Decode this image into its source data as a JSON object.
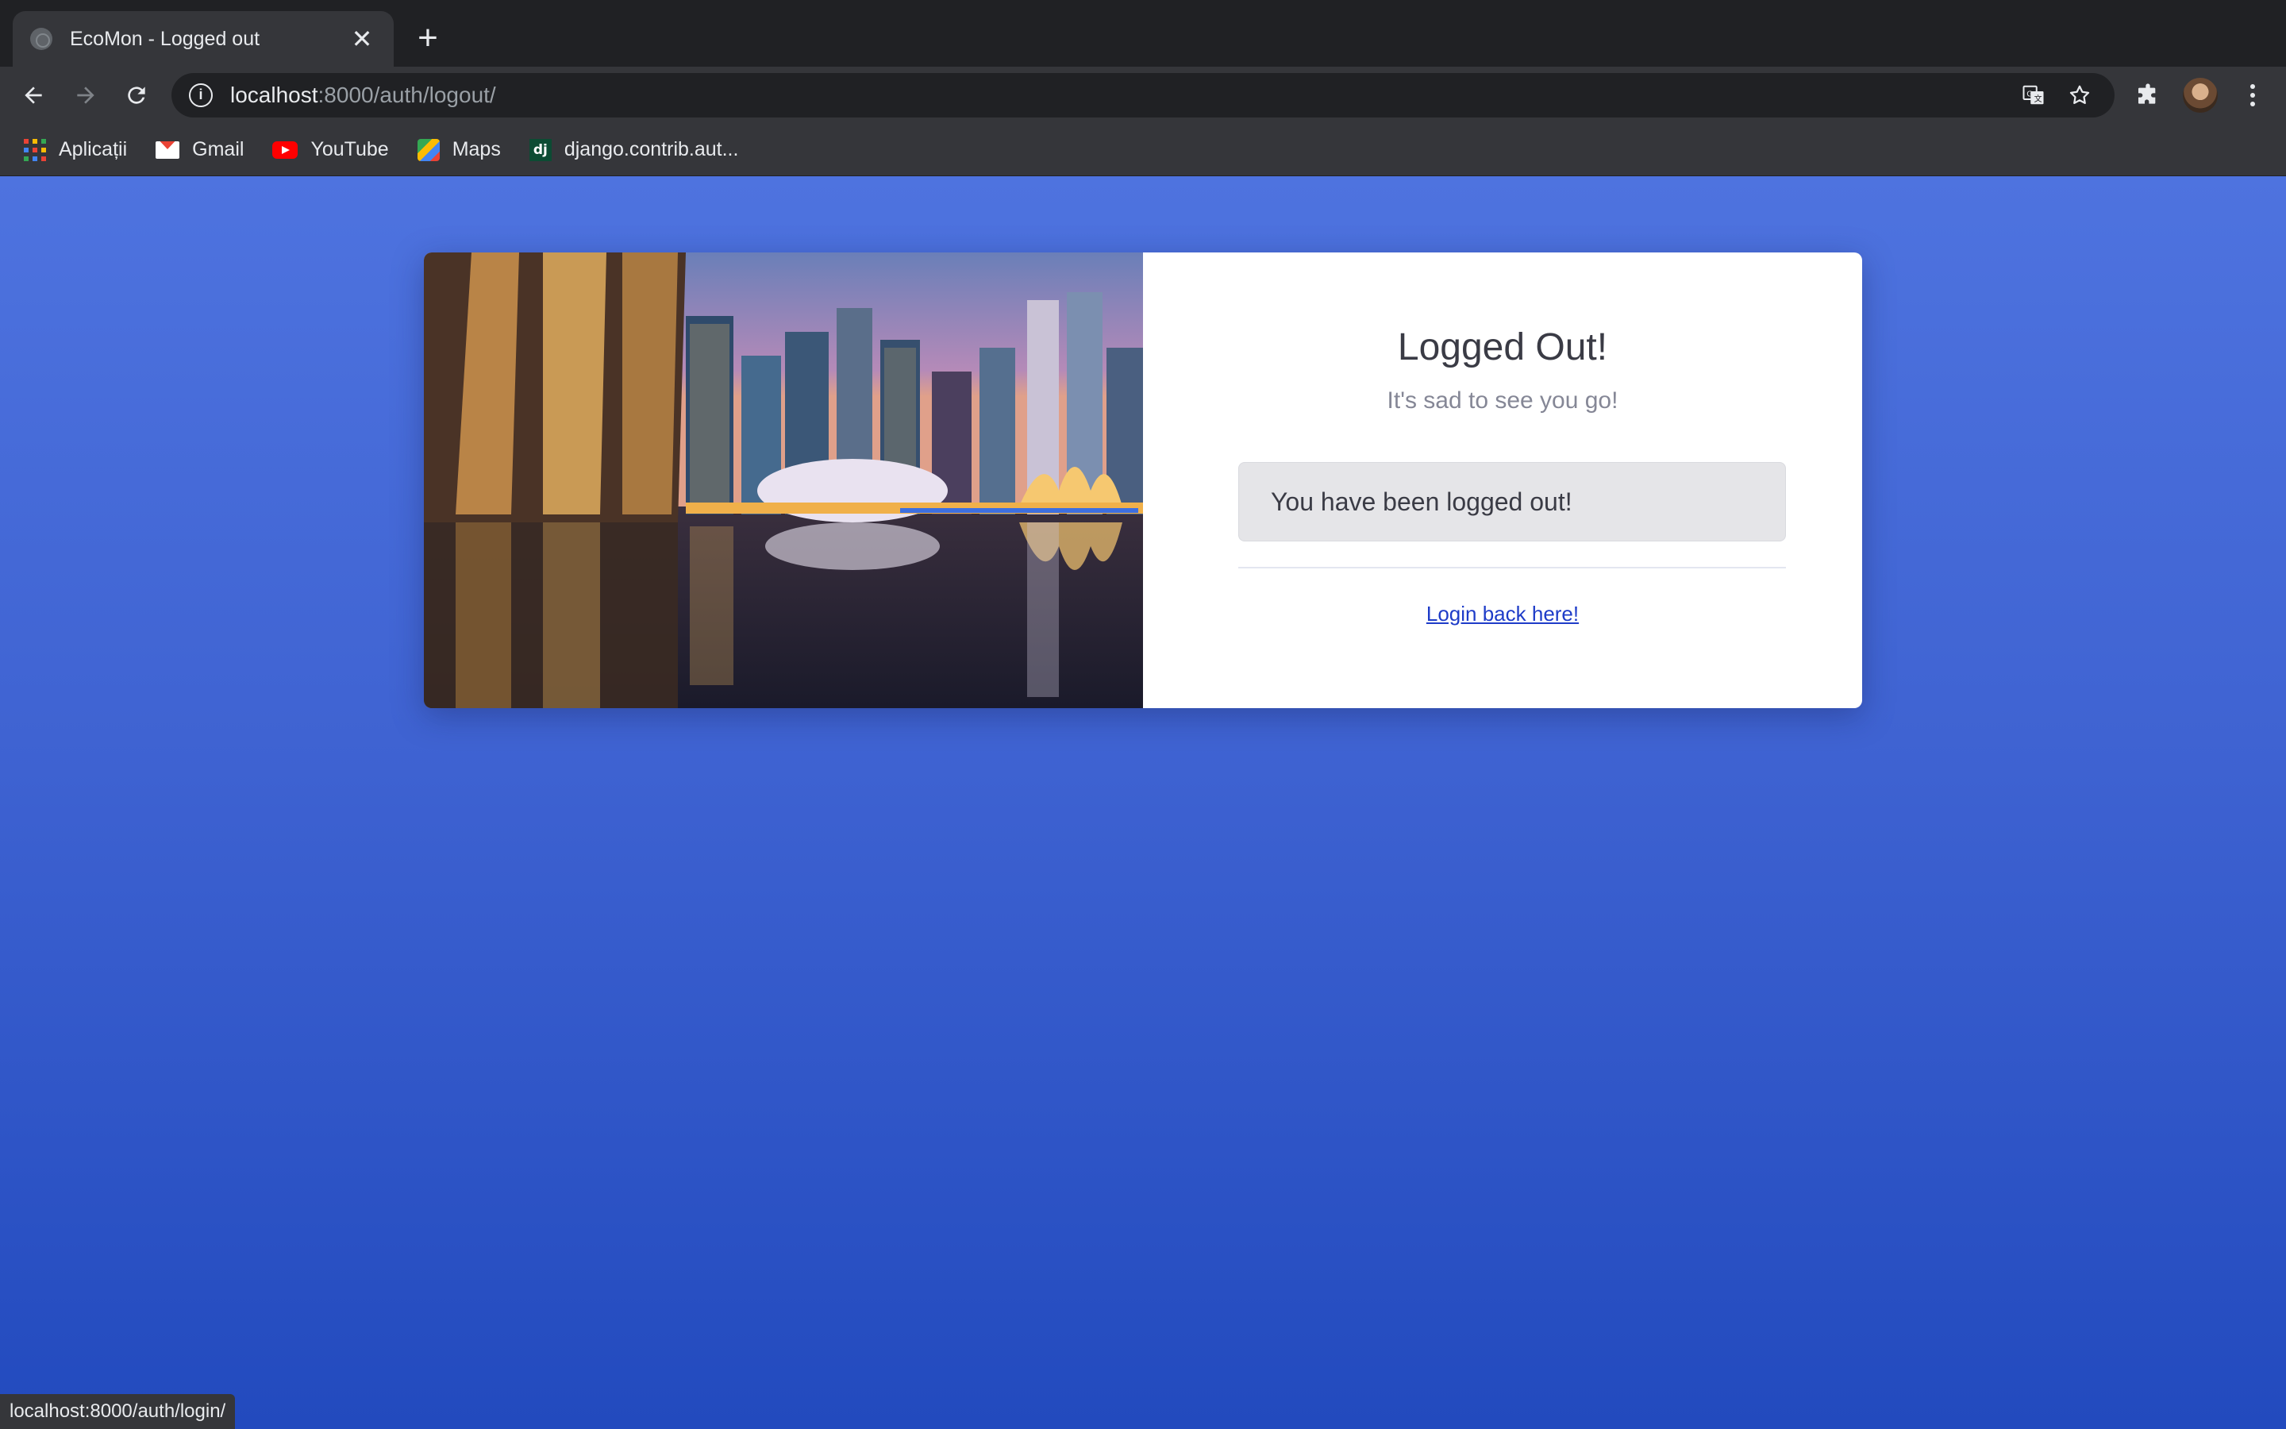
{
  "browser": {
    "tab": {
      "title": "EcoMon - Logged out",
      "close_glyph": "✕"
    },
    "new_tab_glyph": "+",
    "url": {
      "host": "localhost",
      "rest": ":8000/auth/logout/"
    },
    "bookmarks": [
      {
        "label": "Aplicații",
        "icon": "apps-grid-icon"
      },
      {
        "label": "Gmail",
        "icon": "gmail-icon"
      },
      {
        "label": "YouTube",
        "icon": "youtube-icon"
      },
      {
        "label": "Maps",
        "icon": "maps-icon"
      },
      {
        "label": "django.contrib.aut...",
        "icon": "django-icon",
        "icon_text": "dj"
      }
    ],
    "status_url": "localhost:8000/auth/login/"
  },
  "logout_card": {
    "heading": "Logged Out!",
    "subheading": "It's sad to see you go!",
    "alert_text": "You have been logged out!",
    "login_link": "Login back here!"
  },
  "colors": {
    "page_gradient_top": "#4e73df",
    "page_gradient_bottom": "#224abe",
    "link": "#1e3cc8"
  }
}
